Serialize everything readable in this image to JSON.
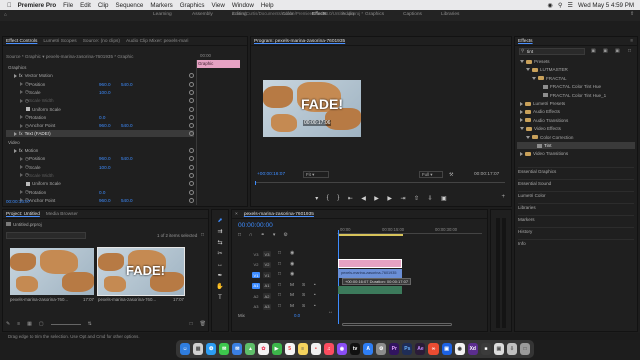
{
  "menubar": {
    "app": "Premiere Pro",
    "items": [
      "File",
      "Edit",
      "Clip",
      "Sequence",
      "Markers",
      "Graphics",
      "View",
      "Window",
      "Help"
    ],
    "clock": "Wed May 5  4:59 PM"
  },
  "workspaces": {
    "tabs": [
      "Learning",
      "Assembly",
      "Editing",
      "Color",
      "Effects",
      "Audio",
      "Graphics",
      "Captions",
      "Libraries"
    ],
    "active": "Effects",
    "path": "/Users/Curtis/Documents/Adobe/Premiere Pro/14.0/Untitled.prproj *"
  },
  "effect_controls": {
    "tabs": [
      "Effect Controls",
      "Lumetri Scopes",
      "Source: (no clips)",
      "Audio Clip Mixer: pexels-mari"
    ],
    "source": "Source * Graphic",
    "sequence": "pexels-marina-zasorina-7601935 * Graphic",
    "ruler_time": "00:00",
    "clip_label": "Graphic",
    "rows": [
      {
        "label": "Graphics",
        "indent": 0,
        "type": "section"
      },
      {
        "label": "Vector Motion",
        "indent": 1,
        "type": "fx"
      },
      {
        "label": "Position",
        "indent": 2,
        "v1": "960.0",
        "v2": "540.0"
      },
      {
        "label": "Scale",
        "indent": 2,
        "v1": "100.0"
      },
      {
        "label": "Scale Width",
        "indent": 2,
        "dim": true
      },
      {
        "label": "Uniform Scale",
        "indent": 3,
        "check": true
      },
      {
        "label": "Rotation",
        "indent": 2,
        "v1": "0.0"
      },
      {
        "label": "Anchor Point",
        "indent": 2,
        "v1": "960.0",
        "v2": "540.0"
      },
      {
        "label": "Text (FADE!)",
        "indent": 1,
        "type": "fx",
        "selected": true
      },
      {
        "label": "Video",
        "indent": 0,
        "type": "section"
      },
      {
        "label": "Motion",
        "indent": 1,
        "type": "fx"
      },
      {
        "label": "Position",
        "indent": 2,
        "v1": "960.0",
        "v2": "540.0"
      },
      {
        "label": "Scale",
        "indent": 2,
        "v1": "100.0"
      },
      {
        "label": "Scale Width",
        "indent": 2,
        "dim": true
      },
      {
        "label": "Uniform Scale",
        "indent": 3,
        "check": true
      },
      {
        "label": "Rotation",
        "indent": 2,
        "v1": "0.0"
      },
      {
        "label": "Anchor Point",
        "indent": 2,
        "v1": "960.0",
        "v2": "540.0"
      }
    ],
    "footer_time": "00:00:16:07"
  },
  "program": {
    "title": "Program: pexels-marina-zasorina-7601935",
    "overlay_text": "FADE!",
    "overlay_time": "00:00:17:06",
    "timecode": "+00:00:16:07",
    "fit": "Fit",
    "quality": "Full",
    "duration": "00:00:17:07"
  },
  "effects": {
    "title": "Effects",
    "search": "tint",
    "tree": [
      {
        "label": "Presets",
        "indent": 0,
        "open": true,
        "folder": true
      },
      {
        "label": "LUTMASTER",
        "indent": 1,
        "open": true,
        "folder": true
      },
      {
        "label": "FRACTAL",
        "indent": 2,
        "open": true,
        "folder": true
      },
      {
        "label": "FRACTAL Color Tint Hue",
        "indent": 3,
        "fx": true
      },
      {
        "label": "FRACTAL Color Tint Hue_1",
        "indent": 3,
        "fx": true
      },
      {
        "label": "Lumetri Presets",
        "indent": 0,
        "folder": true
      },
      {
        "label": "Audio Effects",
        "indent": 0,
        "folder": true
      },
      {
        "label": "Audio Transitions",
        "indent": 0,
        "folder": true
      },
      {
        "label": "Video Effects",
        "indent": 0,
        "open": true,
        "folder": true
      },
      {
        "label": "Color Correction",
        "indent": 1,
        "open": true,
        "folder": true
      },
      {
        "label": "Tint",
        "indent": 2,
        "fx": true,
        "selected": true
      },
      {
        "label": "Video Transitions",
        "indent": 0,
        "folder": true
      }
    ],
    "panels": [
      "Essential Graphics",
      "Essential Sound",
      "Lumetri Color",
      "Libraries",
      "Markers",
      "History",
      "Info"
    ]
  },
  "project": {
    "tabs": [
      "Project: Untitled",
      "Media Browser"
    ],
    "file": "Untitled.prproj",
    "count": "1 of 2 items selected",
    "items": [
      {
        "name": "pexels-marina-zasorina-760...",
        "dur": "17:07"
      },
      {
        "name": "pexels-marina-zasorina-760...",
        "dur": "17:07",
        "text": "FADE!"
      }
    ]
  },
  "timeline": {
    "title": "pexels-marina-zasorina-7601935",
    "timecode": "00:00:00:00",
    "ruler": [
      "00:00",
      "00:00:15:00",
      "00:00:30:00"
    ],
    "video_tracks": [
      "V3",
      "V2",
      "V1"
    ],
    "audio_tracks": [
      "A1",
      "A2",
      "A3"
    ],
    "mix": "Mix",
    "mix_val": "0.0",
    "clip_name": "pexels-marina-zasorina-7601935",
    "tooltip": "+00:00:16:07 Duration: 00:00:17:07",
    "audio_m": "M",
    "audio_s": "S"
  },
  "status": "Drag edge to trim the selection. Use Opt and Cmd for other options.",
  "colors": {
    "accent": "#3d8cff",
    "clip_pink": "#e6a2c3",
    "clip_blue": "#6b8fd6",
    "audio_green": "#3c7a5b"
  }
}
